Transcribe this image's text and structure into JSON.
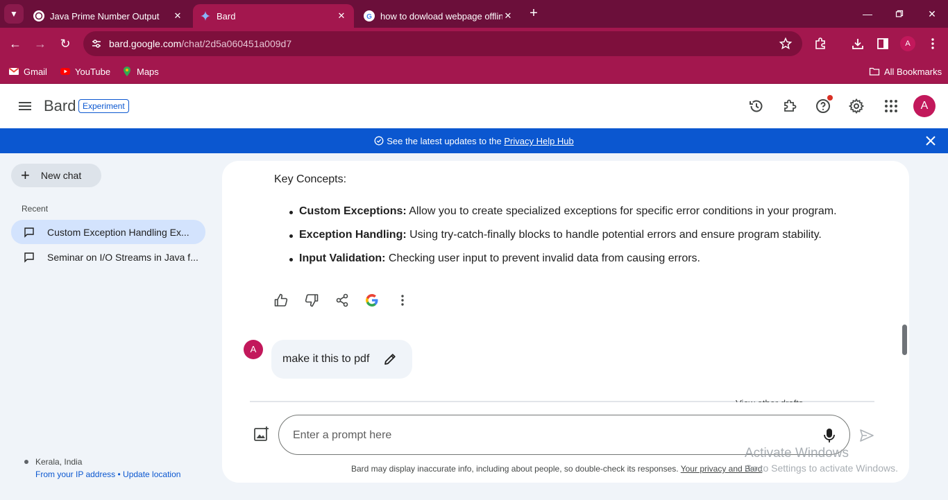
{
  "browser": {
    "tabs": [
      {
        "title": "Java Prime Number Output",
        "active": false
      },
      {
        "title": "Bard",
        "active": true
      },
      {
        "title": "how to dowload webpage offlin",
        "active": false
      }
    ],
    "url_host": "bard.google.com",
    "url_path": "/chat/2d5a060451a009d7",
    "profile_initial": "A",
    "bookmarks": [
      "Gmail",
      "YouTube",
      "Maps"
    ],
    "all_bookmarks": "All Bookmarks"
  },
  "app": {
    "brand": "Bard",
    "badge": "Experiment",
    "avatar_initial": "A",
    "banner_text": "See the latest updates to the ",
    "banner_link": "Privacy Help Hub"
  },
  "sidebar": {
    "new_chat": "New chat",
    "recent_label": "Recent",
    "history": [
      {
        "title": "Custom Exception Handling Ex...",
        "active": true
      },
      {
        "title": "Seminar on I/O Streams in Java f...",
        "active": false
      }
    ],
    "location": "Kerala, India",
    "location_source": "From your IP address",
    "location_sep": " • ",
    "update_location": "Update location"
  },
  "conversation": {
    "key_concepts_title": "Key Concepts:",
    "concepts": [
      {
        "term": "Custom Exceptions:",
        "desc": " Allow you to create specialized exceptions for specific error conditions in your program."
      },
      {
        "term": "Exception Handling:",
        "desc": " Using try-catch-finally blocks to handle potential errors and ensure program stability."
      },
      {
        "term": "Input Validation:",
        "desc": " Checking user input to prevent invalid data from causing errors."
      }
    ],
    "user_initial": "A",
    "user_message": "make it this to pdf",
    "cut_off_text": "View other drafts"
  },
  "composer": {
    "placeholder": "Enter a prompt here",
    "disclaimer": "Bard may display inaccurate info, including about people, so double-check its responses. ",
    "disclaimer_link": "Your privacy and Bard"
  },
  "watermark": {
    "line1": "Activate Windows",
    "line2": "Go to Settings to activate Windows."
  },
  "colors": {
    "tabstrip": "#6b0f3a",
    "toolbar": "#a3174e",
    "accent_blue": "#0b57d0",
    "avatar": "#c2185b"
  }
}
